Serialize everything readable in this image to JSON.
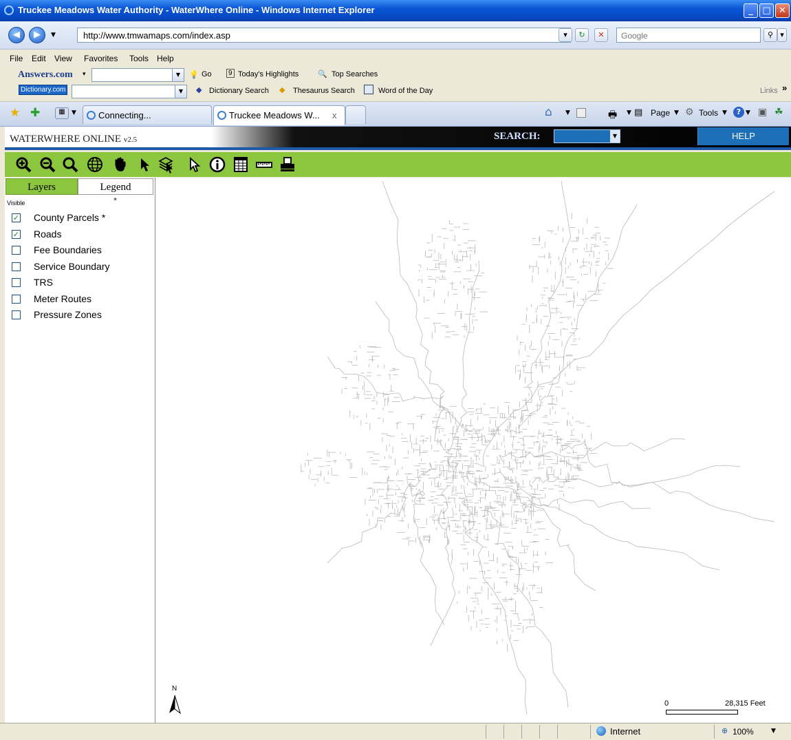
{
  "window": {
    "title": "Truckee Meadows Water Authority - WaterWhere Online - Windows Internet Explorer"
  },
  "address": {
    "url": "http://www.tmwamaps.com/index.asp",
    "search_placeholder": "Google"
  },
  "menu": [
    "File",
    "Edit",
    "View",
    "Favorites",
    "Tools",
    "Help"
  ],
  "answers_bar": {
    "brand": "Answers.com",
    "go": "Go",
    "highlights": "Today's Highlights",
    "highlights_badge": "9",
    "top_searches": "Top Searches"
  },
  "dictionary_bar": {
    "brand": "Dictionary.com",
    "dictionary_search": "Dictionary Search",
    "thesaurus_search": "Thesaurus Search",
    "word_of_day": "Word of the Day",
    "links": "Links",
    "chevron": "»"
  },
  "tabs": [
    {
      "label": "Connecting..."
    },
    {
      "label": "Truckee Meadows W...",
      "close": "x"
    }
  ],
  "command_bar": {
    "page": "Page",
    "tools": "Tools"
  },
  "app": {
    "brand": "WATERWHERE ONLINE",
    "version": "v2.5",
    "search_label": "SEARCH:",
    "help_label": "HELP"
  },
  "panel": {
    "tab_layers": "Layers",
    "tab_legend": "Legend",
    "visible_header": "Visible",
    "star": "*",
    "layers": [
      {
        "name": "County Parcels *",
        "checked": true
      },
      {
        "name": "Roads",
        "checked": true
      },
      {
        "name": "Fee Boundaries",
        "checked": false
      },
      {
        "name": "Service Boundary",
        "checked": false
      },
      {
        "name": "TRS",
        "checked": false
      },
      {
        "name": "Meter Routes",
        "checked": false
      },
      {
        "name": "Pressure Zones",
        "checked": false
      }
    ]
  },
  "map": {
    "north_label": "N",
    "scale_min": "0",
    "scale_max": "28,315 Feet"
  },
  "status": {
    "zone": "Internet",
    "zoom": "100%"
  }
}
